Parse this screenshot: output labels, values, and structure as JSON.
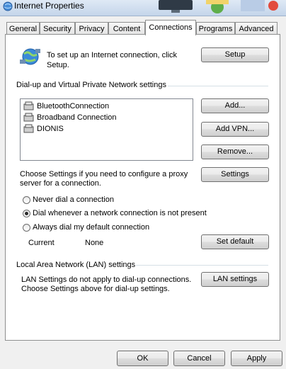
{
  "window": {
    "title": "Internet Properties"
  },
  "tabs": [
    {
      "label": "General"
    },
    {
      "label": "Security"
    },
    {
      "label": "Privacy"
    },
    {
      "label": "Content"
    },
    {
      "label": "Connections"
    },
    {
      "label": "Programs"
    },
    {
      "label": "Advanced"
    }
  ],
  "active_tab": "Connections",
  "setup": {
    "text": "To set up an Internet connection, click Setup.",
    "text_line1": "To set up an Internet connection, click",
    "text_line2": "Setup.",
    "button": "Setup"
  },
  "dialup": {
    "group_label": "Dial-up and Virtual Private Network settings",
    "connections": [
      {
        "name": "BluetoothConnection"
      },
      {
        "name": "Broadband Connection"
      },
      {
        "name": "DIONIS"
      }
    ],
    "add_button": "Add...",
    "add_vpn_button": "Add VPN...",
    "remove_button": "Remove...",
    "settings_text_line1": "Choose Settings if you need to configure a proxy",
    "settings_text_line2": "server for a connection.",
    "settings_button": "Settings",
    "radios": [
      {
        "label": "Never dial a connection",
        "selected": false
      },
      {
        "label": "Dial whenever a network connection is not present",
        "selected": true
      },
      {
        "label": "Always dial my default connection",
        "selected": false
      }
    ],
    "current_label": "Current",
    "current_value": "None",
    "set_default_button": "Set default"
  },
  "lan": {
    "group_label": "Local Area Network (LAN) settings",
    "text_line1": "LAN Settings do not apply to dial-up connections.",
    "text_line2": "Choose Settings above for dial-up settings.",
    "button": "LAN settings"
  },
  "footer": {
    "ok": "OK",
    "cancel": "Cancel",
    "apply": "Apply"
  }
}
